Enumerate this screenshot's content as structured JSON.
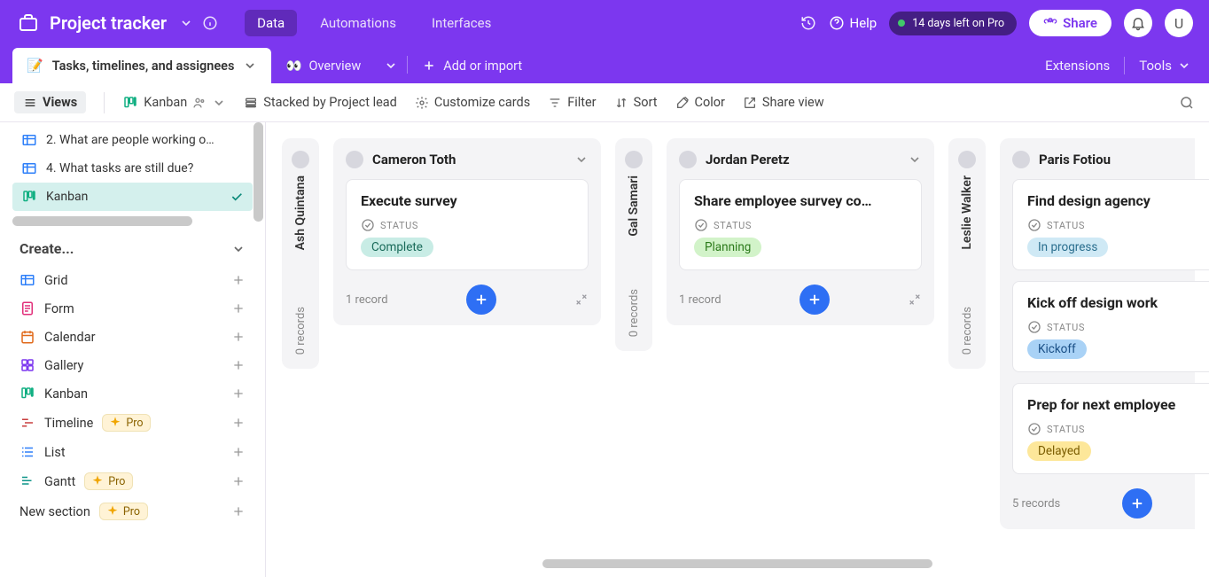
{
  "app_title": "Project tracker",
  "top_nav": {
    "data": "Data",
    "automations": "Automations",
    "interfaces": "Interfaces"
  },
  "help_label": "Help",
  "trial_text": "14 days left on Pro",
  "share_label": "Share",
  "user_initial": "U",
  "tabs": {
    "active_table": "Tasks, timelines, and assignees",
    "overview": "Overview",
    "add": "Add or import",
    "extensions": "Extensions",
    "tools": "Tools"
  },
  "toolbar": {
    "views": "Views",
    "kanban": "Kanban",
    "stacked": "Stacked by Project lead",
    "customize": "Customize cards",
    "filter": "Filter",
    "sort": "Sort",
    "color": "Color",
    "share_view": "Share view"
  },
  "sidebar": {
    "views": [
      {
        "label": "2. What are people working o…"
      },
      {
        "label": "4. What tasks are still due?"
      },
      {
        "label": "Kanban"
      }
    ],
    "create_label": "Create...",
    "items": {
      "grid": "Grid",
      "form": "Form",
      "calendar": "Calendar",
      "gallery": "Gallery",
      "kanban": "Kanban",
      "timeline": "Timeline",
      "list": "List",
      "gantt": "Gantt",
      "new_section": "New section"
    },
    "pro_badge": "Pro"
  },
  "board": {
    "status_label": "STATUS",
    "lanes": {
      "ash": {
        "name": "Ash Quintana",
        "count": "0 records"
      },
      "cameron": {
        "name": "Cameron Toth",
        "count": "1 record",
        "cards": [
          {
            "title": "Execute survey",
            "status_key": "complete",
            "status_text": "Complete"
          }
        ]
      },
      "gal": {
        "name": "Gal Samari",
        "count": "0 records"
      },
      "jordan": {
        "name": "Jordan Peretz",
        "count": "1 record",
        "cards": [
          {
            "title": "Share employee survey co…",
            "status_key": "planning",
            "status_text": "Planning"
          }
        ]
      },
      "leslie": {
        "name": "Leslie Walker",
        "count": "0 records"
      },
      "paris": {
        "name": "Paris Fotiou",
        "count": "5 records",
        "cards": [
          {
            "title": "Find design agency",
            "status_key": "inprogress",
            "status_text": "In progress"
          },
          {
            "title": "Kick off design work",
            "status_key": "kickoff",
            "status_text": "Kickoff"
          },
          {
            "title": "Prep for next employee",
            "status_key": "delayed",
            "status_text": "Delayed"
          }
        ]
      }
    }
  }
}
